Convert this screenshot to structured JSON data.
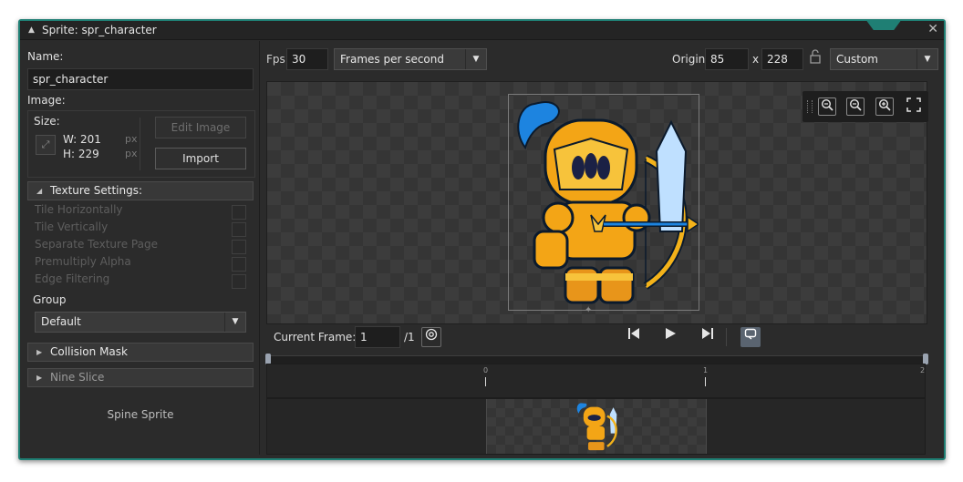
{
  "window": {
    "title": "Sprite: spr_character"
  },
  "left": {
    "name_label": "Name:",
    "name_value": "spr_character",
    "image_label": "Image:",
    "size_label": "Size:",
    "width_text": "W: 201",
    "height_text": "H: 229",
    "unit": "px",
    "edit_image": "Edit Image",
    "import": "Import",
    "texture_settings": "Texture Settings:",
    "options": [
      "Tile Horizontally",
      "Tile Vertically",
      "Separate Texture Page",
      "Premultiply Alpha",
      "Edge Filtering"
    ],
    "group_label": "Group",
    "group_value": "Default",
    "collision_mask": "Collision Mask",
    "nine_slice": "Nine Slice",
    "spine_sprite": "Spine Sprite"
  },
  "toolbar": {
    "fps_label": "Fps",
    "fps_value": "30",
    "fps_mode": "Frames per second",
    "origin_label": "Origin",
    "origin_x": "85",
    "origin_sep": "x",
    "origin_y": "228",
    "origin_preset": "Custom"
  },
  "playback": {
    "current_frame_label": "Current Frame:",
    "current_frame_value": "1",
    "frame_total": "/1"
  },
  "timeline": {
    "tick_labels": [
      "0",
      "1",
      "2"
    ]
  },
  "colors": {
    "accent": "#1f7f74",
    "panel": "#2b2b2b"
  }
}
